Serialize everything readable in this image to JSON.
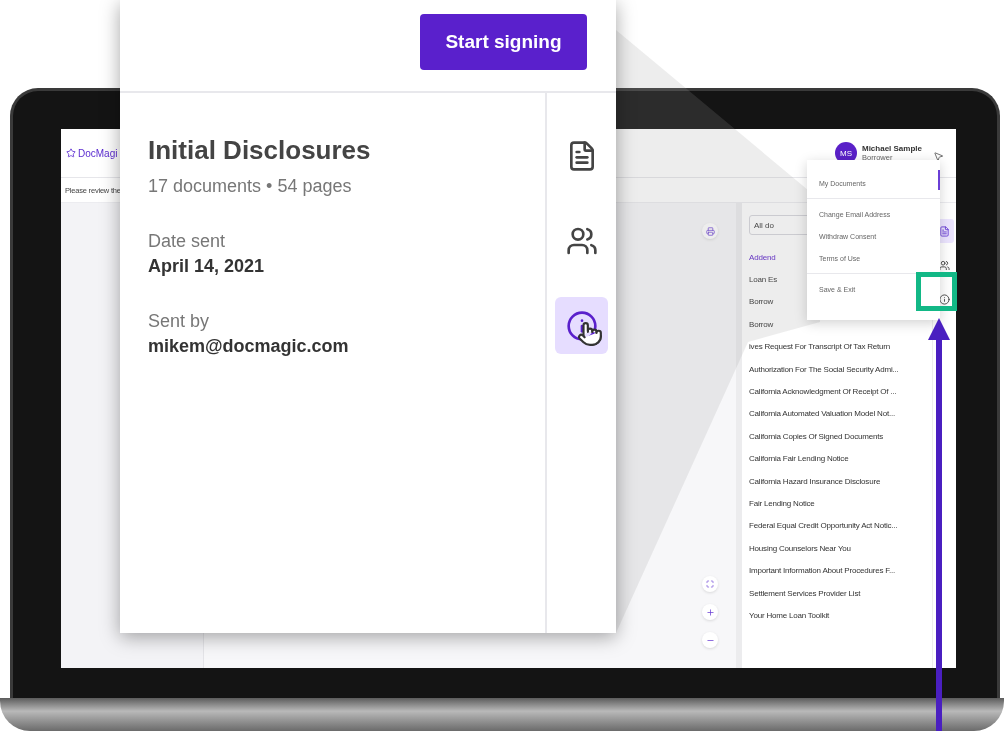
{
  "app": {
    "logo": "DocMagi",
    "notice": "Please review the",
    "user": {
      "initials": "MS",
      "name": "Michael Sample",
      "role": "Borrower"
    }
  },
  "documents": {
    "filter": "All do",
    "items": [
      {
        "title": "Addend",
        "selected": true
      },
      {
        "title": "Loan Es",
        "selected": false
      },
      {
        "title": "Borrow",
        "selected": false
      },
      {
        "title": "Borrow",
        "selected": false
      },
      {
        "title": "ives Request For Transcript Of Tax Return",
        "selected": false
      },
      {
        "title": "Authorization For The Social Security Admi...",
        "selected": false
      },
      {
        "title": "California Acknowledgment Of Receipt Of ...",
        "selected": false
      },
      {
        "title": "California Automated Valuation Model Not...",
        "selected": false
      },
      {
        "title": "California Copies Of Signed Documents",
        "selected": false
      },
      {
        "title": "California Fair Lending Notice",
        "selected": false
      },
      {
        "title": "California Hazard Insurance Disclosure",
        "selected": false
      },
      {
        "title": "Fair Lending Notice",
        "selected": false
      },
      {
        "title": "Federal Equal Credit Opportunity Act Notic...",
        "selected": false
      },
      {
        "title": "Housing Counselors Near You",
        "selected": false
      },
      {
        "title": "Important Information About Procedures F...",
        "selected": false
      },
      {
        "title": "Settlement Services Provider List",
        "selected": false
      },
      {
        "title": "Your Home Loan Toolkit",
        "selected": false
      }
    ]
  },
  "side_tabs": [
    {
      "kind": "document",
      "selected": true
    },
    {
      "kind": "people",
      "selected": false
    },
    {
      "kind": "info",
      "selected": false
    }
  ],
  "menu": {
    "sections": [
      {
        "items": [
          {
            "label": "My Documents"
          }
        ]
      },
      {
        "items": [
          {
            "label": "Change Email Address"
          },
          {
            "label": "Withdraw Consent"
          },
          {
            "label": "Terms of Use"
          }
        ]
      },
      {
        "items": [
          {
            "label": "Save & Exit"
          }
        ]
      }
    ]
  },
  "callout": {
    "button": "Start signing",
    "title": "Initial Disclosures",
    "subtitle": "17 documents • 54 pages",
    "fields": [
      {
        "label": "Date sent",
        "value": "April 14, 2021"
      },
      {
        "label": "Sent by",
        "value": "mikem@docmagic.com"
      }
    ],
    "tabs": [
      {
        "kind": "document",
        "selected": false
      },
      {
        "kind": "people",
        "selected": false
      },
      {
        "kind": "info",
        "selected": true
      }
    ]
  }
}
